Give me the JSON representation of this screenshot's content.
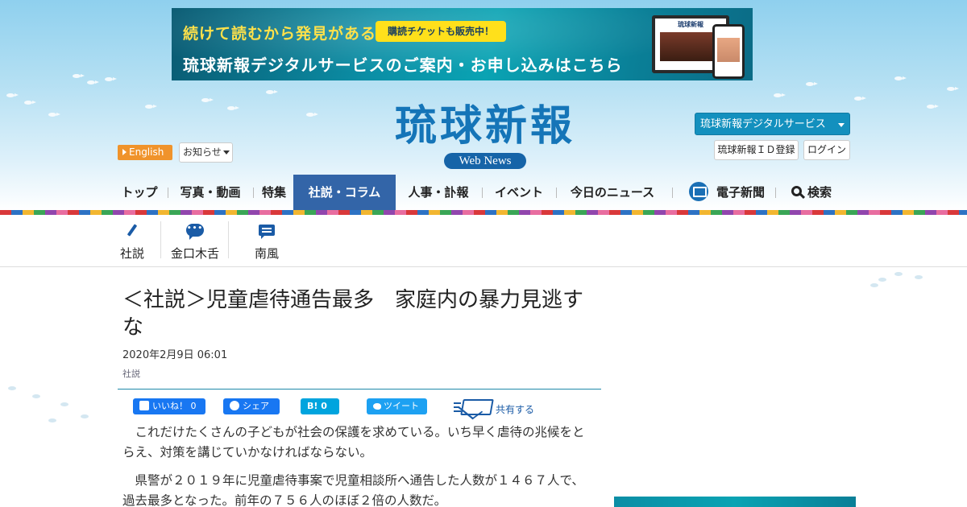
{
  "banner": {
    "line1": "続けて読むから発見がある",
    "badge": "購読チケットも販売中！",
    "line2": "琉球新報デジタルサービスのご案内・お申し込みはこちら",
    "monitor_title": "琉球新報"
  },
  "logo": {
    "title": "琉球新報",
    "subtitle": "Web News"
  },
  "header": {
    "english": "English",
    "notice": "お知らせ",
    "digital_service": "琉球新報デジタルサービス",
    "id_register": "琉球新報ＩＤ登録",
    "login": "ログイン"
  },
  "nav": {
    "items": [
      "トップ",
      "写真・動画",
      "特集",
      "社説・コラム",
      "人事・訃報",
      "イベント",
      "今日のニュース",
      "電子新聞",
      "検索"
    ],
    "active": "社説・コラム"
  },
  "subnav": {
    "items": [
      "社説",
      "金口木舌",
      "南風"
    ],
    "bubble_text": "•••"
  },
  "article": {
    "headline": "＜社説＞児童虐待通告最多　家庭内の暴力見逃すな",
    "date": "2020年2月9日 06:01",
    "category": "社説",
    "paragraphs": [
      "これだけたくさんの子どもが社会の保護を求めている。いち早く虐待の兆候をとらえ、対策を講じていかなければならない。",
      "県警が２０１９年に児童虐待事案で児童相談所へ通告した人数が１４６７人で、過去最多となった。前年の７５６人のほぼ２倍の人数だ。"
    ]
  },
  "share": {
    "fb_like": "いいね！ 0",
    "fb_share": "シェア",
    "hatena": "B! 0",
    "tweet": "ツイート",
    "share_more": "共有する"
  },
  "colors": {
    "accent": "#3365a8",
    "logo": "#1575b8",
    "english_btn": "#f0932b",
    "digital_btn": "#1390be"
  }
}
